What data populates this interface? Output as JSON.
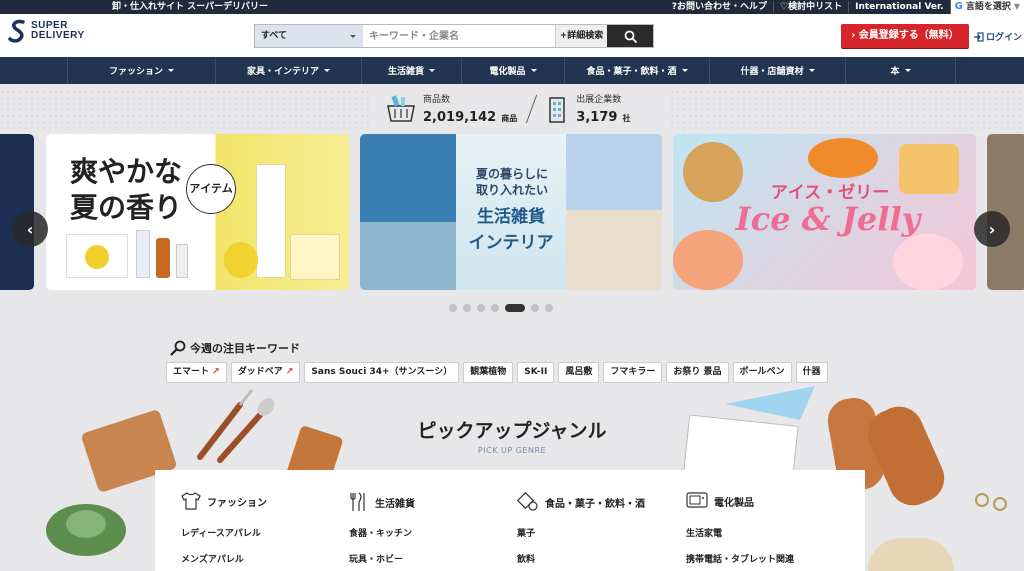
{
  "topbar": {
    "tagline": "卸・仕入れサイト スーパーデリバリー",
    "links": [
      "?お問い合わせ・ヘルプ",
      "♡検討中リスト",
      "International Ver."
    ],
    "language": "言語を選択"
  },
  "header": {
    "logo": [
      "SUPER",
      "DELIVERY"
    ],
    "search_category": "すべて",
    "search_placeholder": "キーワード・企業名",
    "advanced_search": "+詳細検索",
    "register": "会員登録する（無料）",
    "login": "ログイン"
  },
  "nav": {
    "items": [
      {
        "label": "ファッション"
      },
      {
        "label": "家具・インテリア"
      },
      {
        "label": "生活雑貨"
      },
      {
        "label": "電化製品"
      },
      {
        "label": "食品・菓子・飲料・酒"
      },
      {
        "label": "什器・店舗資材"
      },
      {
        "label": "本"
      }
    ]
  },
  "stats": {
    "products_label": "商品数",
    "products_value": "2,019,142",
    "products_unit": "商品",
    "companies_label": "出展企業数",
    "companies_value": "3,179",
    "companies_unit": "社"
  },
  "banners": {
    "b1": {
      "line1": "爽やかな",
      "line2": "夏の香り",
      "badge": "アイテム"
    },
    "b2": {
      "line1": "夏の暮らしに",
      "line2": "取り入れたい",
      "line3": "生活雑貨",
      "line4": "インテリア"
    },
    "b3": {
      "line1": "アイス・ゼリー",
      "line2": "Ice & Jelly"
    },
    "dots_count": 7,
    "active_dot": 4
  },
  "keywords": {
    "title": "今週の注目キーワード",
    "items": [
      {
        "label": "エマート",
        "trend": "↗"
      },
      {
        "label": "ダッドベア",
        "trend": "↗"
      },
      {
        "label": "Sans Souci 34+（サンスーシ）"
      },
      {
        "label": "観葉植物"
      },
      {
        "label": "SK-II"
      },
      {
        "label": "風呂敷"
      },
      {
        "label": "フマキラー"
      },
      {
        "label": "お祭り 景品"
      },
      {
        "label": "ボールペン"
      },
      {
        "label": "什器"
      }
    ]
  },
  "pickup": {
    "title": "ピックアップジャンル",
    "subtitle": "PICK UP GENRE",
    "genres": [
      {
        "name": "ファッション",
        "icon": "shirt-icon",
        "subs": [
          "レディースアパレル",
          "メンズアパレル"
        ]
      },
      {
        "name": "生活雑貨",
        "icon": "cutlery-icon",
        "subs": [
          "食器・キッチン",
          "玩具・ホビー"
        ]
      },
      {
        "name": "食品・菓子・飲料・酒",
        "icon": "food-icon",
        "subs": [
          "菓子",
          "飲料"
        ]
      },
      {
        "name": "電化製品",
        "icon": "appliance-icon",
        "subs": [
          "生活家電",
          "携帯電話・タブレット関連"
        ]
      }
    ]
  },
  "colors": {
    "topbar": "#1f2a3a",
    "nav": "#22344f",
    "register": "#d6252b",
    "background": "#e7e7e9"
  }
}
